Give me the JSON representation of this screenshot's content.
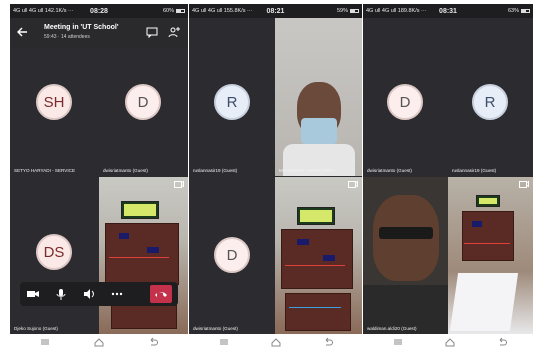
{
  "colors": {
    "hangup": "#c4314b",
    "panel_bg": "#2b2b2e"
  },
  "screen1": {
    "status": {
      "left": "4G ull 4G ull 142.1K/s ···",
      "time": "08:28",
      "right": "60%"
    },
    "meeting": {
      "title": "Meeting in 'UT School'",
      "subtitle": "59:43 · 14 attendees"
    },
    "tiles": [
      {
        "initials": "SH",
        "name": "SETYO HARYADI - SERVICE"
      },
      {
        "initials": "D",
        "name": "dwisriatmanto (Guest)"
      },
      {
        "initials": "DS",
        "name": "Djeko Sujono (Guest)"
      }
    ],
    "icons": [
      "back-arrow-icon",
      "chat-icon",
      "people-add-icon",
      "camera-icon",
      "microphone-icon",
      "speaker-icon",
      "more-icon",
      "hangup-icon"
    ]
  },
  "screen2": {
    "status": {
      "left": "4G ull 4G ull 155.8K/s ···",
      "time": "08:21",
      "right": "59%"
    },
    "tiles": [
      {
        "initials": "R",
        "name": "ruslannasir19 (Guest)"
      },
      {
        "name": "MAHMUDIN - NONCORPU"
      },
      {
        "initials": "D",
        "name": "dwisriatmanto (Guest)"
      }
    ]
  },
  "screen3": {
    "status": {
      "left": "4G ull 4G ull 189.8K/s ···",
      "time": "08:31",
      "right": "63%"
    },
    "tiles": [
      {
        "initials": "D",
        "name": "dwisriatmanto (Guest)"
      },
      {
        "initials": "R",
        "name": "ruslannasir19 (Guest)"
      },
      {
        "name": "waldiman.aldi20 (Guest)"
      }
    ]
  }
}
